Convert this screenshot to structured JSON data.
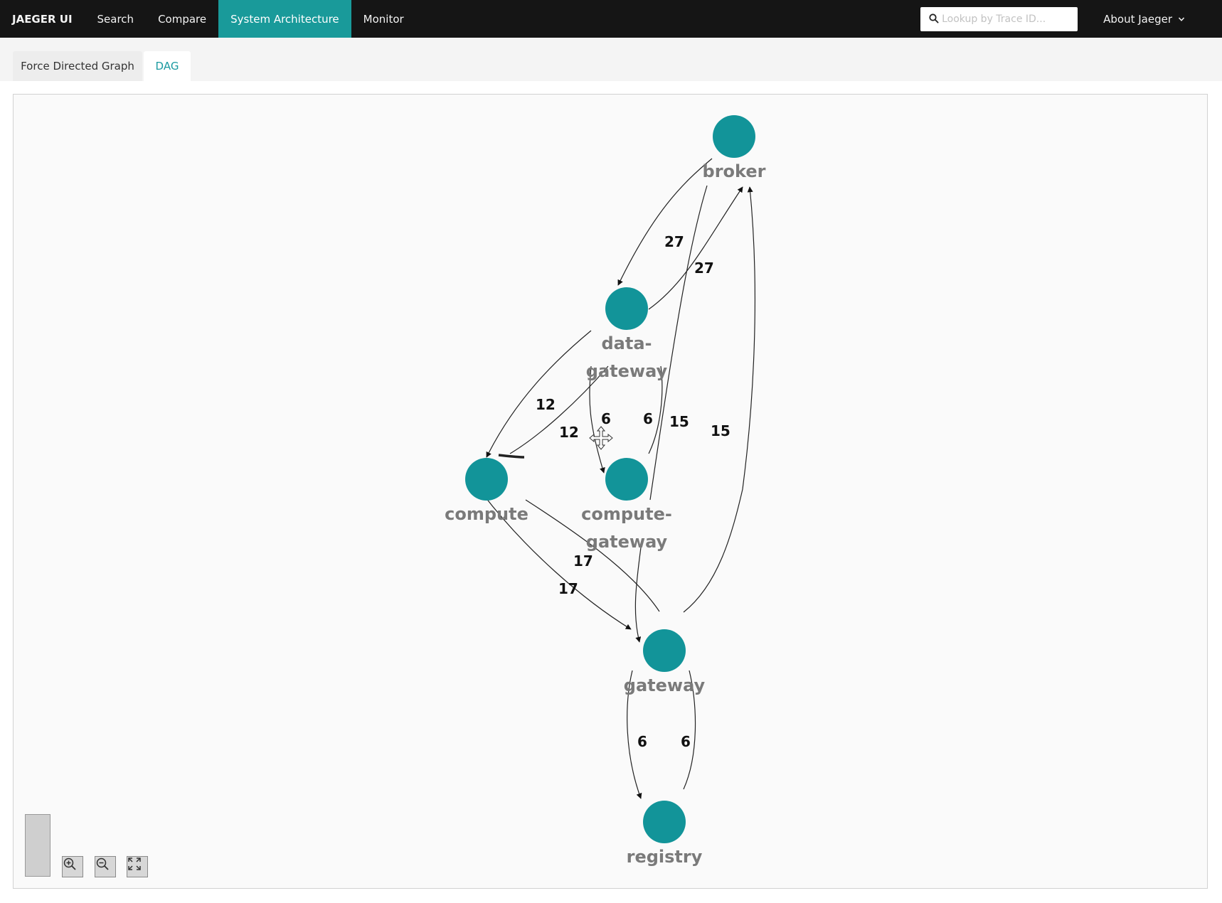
{
  "nav": {
    "brand": "JAEGER UI",
    "items": [
      {
        "label": "Search"
      },
      {
        "label": "Compare"
      },
      {
        "label": "System Architecture"
      },
      {
        "label": "Monitor"
      }
    ],
    "search_placeholder": "Lookup by Trace ID...",
    "about_label": "About Jaeger"
  },
  "tabs": [
    {
      "label": "Force Directed Graph"
    },
    {
      "label": "DAG"
    }
  ],
  "graph": {
    "nodes": [
      {
        "id": "broker",
        "label_lines": [
          "broker"
        ]
      },
      {
        "id": "data-gateway",
        "label_lines": [
          "data-",
          "gateway"
        ]
      },
      {
        "id": "compute",
        "label_lines": [
          "compute"
        ]
      },
      {
        "id": "compute-gateway",
        "label_lines": [
          "compute-",
          "gateway"
        ]
      },
      {
        "id": "gateway",
        "label_lines": [
          "gateway"
        ]
      },
      {
        "id": "registry",
        "label_lines": [
          "registry"
        ]
      }
    ],
    "edge_labels": [
      "27",
      "27",
      "12",
      "12",
      "6",
      "6",
      "15",
      "15",
      "17",
      "17",
      "6",
      "6"
    ]
  },
  "colors": {
    "accent": "#199a9a",
    "node": "#129499",
    "nav_bg": "#151515"
  }
}
